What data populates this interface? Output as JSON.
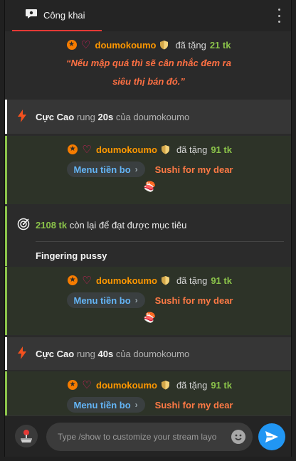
{
  "header": {
    "tab_label": "Công khai",
    "tab_icon": "chat-bubble-icon",
    "menu_icon": "more-vertical-icon"
  },
  "gift_top": {
    "username": "doumokoumo",
    "verb": "đã tặng",
    "amount": "21 tk",
    "message_line1": "“Nếu mập quá thì sẽ cân nhắc đem ra",
    "message_line2": "siêu thị bán đó.”"
  },
  "vibration_1": {
    "level": "Cực Cao",
    "text_rung": "rung",
    "duration": "20s",
    "text_of": "của",
    "username": "doumokoumo"
  },
  "gift_1": {
    "username": "doumokoumo",
    "verb": "đã tặng",
    "amount": "91 tk",
    "menu_label": "Menu tiền bo",
    "item_name": "Sushi for my dear",
    "item_emoji": "🍣"
  },
  "goal": {
    "amount": "2108 tk",
    "text": "còn lại để đạt được mục tiêu",
    "name": "Fingering pussy"
  },
  "gift_2": {
    "username": "doumokoumo",
    "verb": "đã tặng",
    "amount": "91 tk",
    "menu_label": "Menu tiền bo",
    "item_name": "Sushi for my dear",
    "item_emoji": "🍣"
  },
  "vibration_2": {
    "level": "Cực Cao",
    "text_rung": "rung",
    "duration": "40s",
    "text_of": "của",
    "username": "doumokoumo"
  },
  "gift_3": {
    "username": "doumokoumo",
    "verb": "đã tặng",
    "amount": "91 tk",
    "menu_label": "Menu tiền bo",
    "item_name": "Sushi for my dear"
  },
  "composer": {
    "placeholder": "Type /show to customize your stream layo",
    "send_icon": "send-icon",
    "emoji_icon": "emoji-icon",
    "joystick_icon": "joystick-icon"
  },
  "colors": {
    "accent_tab": "#e53935",
    "username": "#ff9800",
    "amount": "#8bc34a",
    "message": "#ff7043",
    "menu_link": "#64b5f6",
    "send_button": "#2196f3"
  }
}
